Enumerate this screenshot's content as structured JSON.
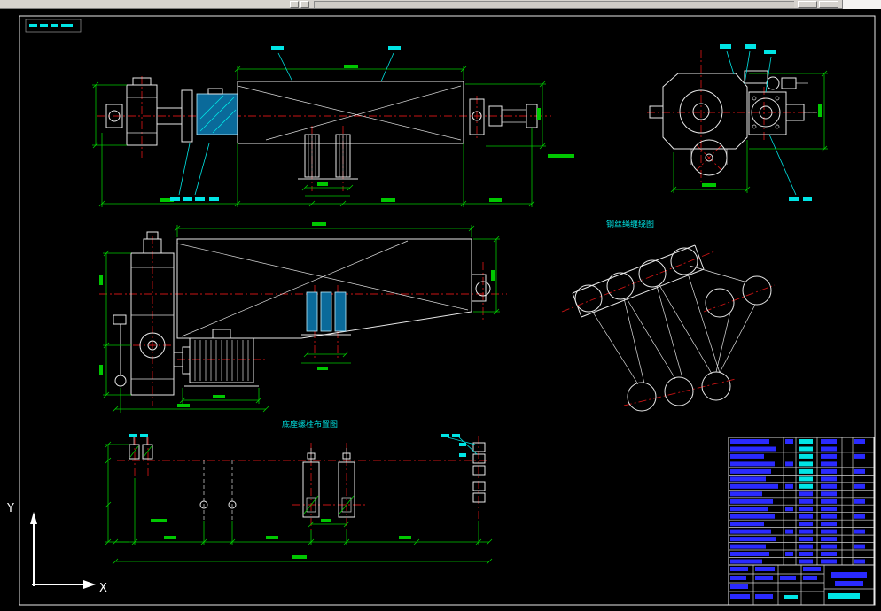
{
  "labels": {
    "reeving_title": "钢丝绳缠绕图",
    "bolt_layout_title": "底座螺栓布置图",
    "ucs_x": "X",
    "ucs_y": "Y"
  },
  "colors": {
    "canvas": "#000000",
    "geometry_white": "#e9e9e9",
    "dimension_green": "#00c800",
    "callout_cyan": "#00e5e5",
    "centerline_red": "#c81414",
    "titleblock_blue": "#2a2aff",
    "ui_grey": "#d6d3ce"
  }
}
